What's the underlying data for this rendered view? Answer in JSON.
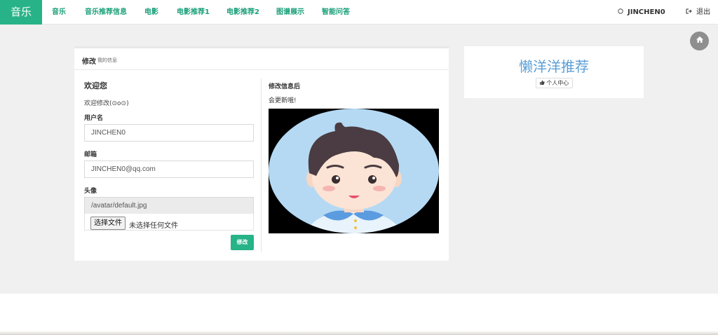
{
  "brand": "音乐",
  "nav": [
    "音乐",
    "音乐推荐信息",
    "电影",
    "电影推荐1",
    "电影推荐2",
    "图谱展示",
    "智能问答"
  ],
  "user": {
    "name": "JINCHEN0",
    "icon": "user-icon"
  },
  "logout": {
    "label": "退出",
    "icon": "sign-out-icon"
  },
  "home_icon": "home-icon",
  "panel": {
    "title": "修改",
    "subtitle": "我的信息",
    "welcome_heading": "欢迎您",
    "welcome_text": "欢迎修改(⊙o⊙)",
    "username_label": "用户名",
    "username_value": "JINCHEN0",
    "email_label": "邮箱",
    "email_value": "JINCHEN0@qq.com",
    "avatar_label": "头像",
    "avatar_path": "/avatar/default.jpg",
    "file_button": "选择文件",
    "file_none": "未选择任何文件",
    "submit": "修改",
    "after_heading": "修改信息后",
    "after_text": "会更新哦!"
  },
  "side": {
    "title": "懒洋洋推荐",
    "button_label": "个人中心",
    "button_icon": "thumbs-up-icon"
  },
  "colors": {
    "brand": "#27b387",
    "nav_link": "#1aa079",
    "side_title": "#5b9fd6"
  }
}
